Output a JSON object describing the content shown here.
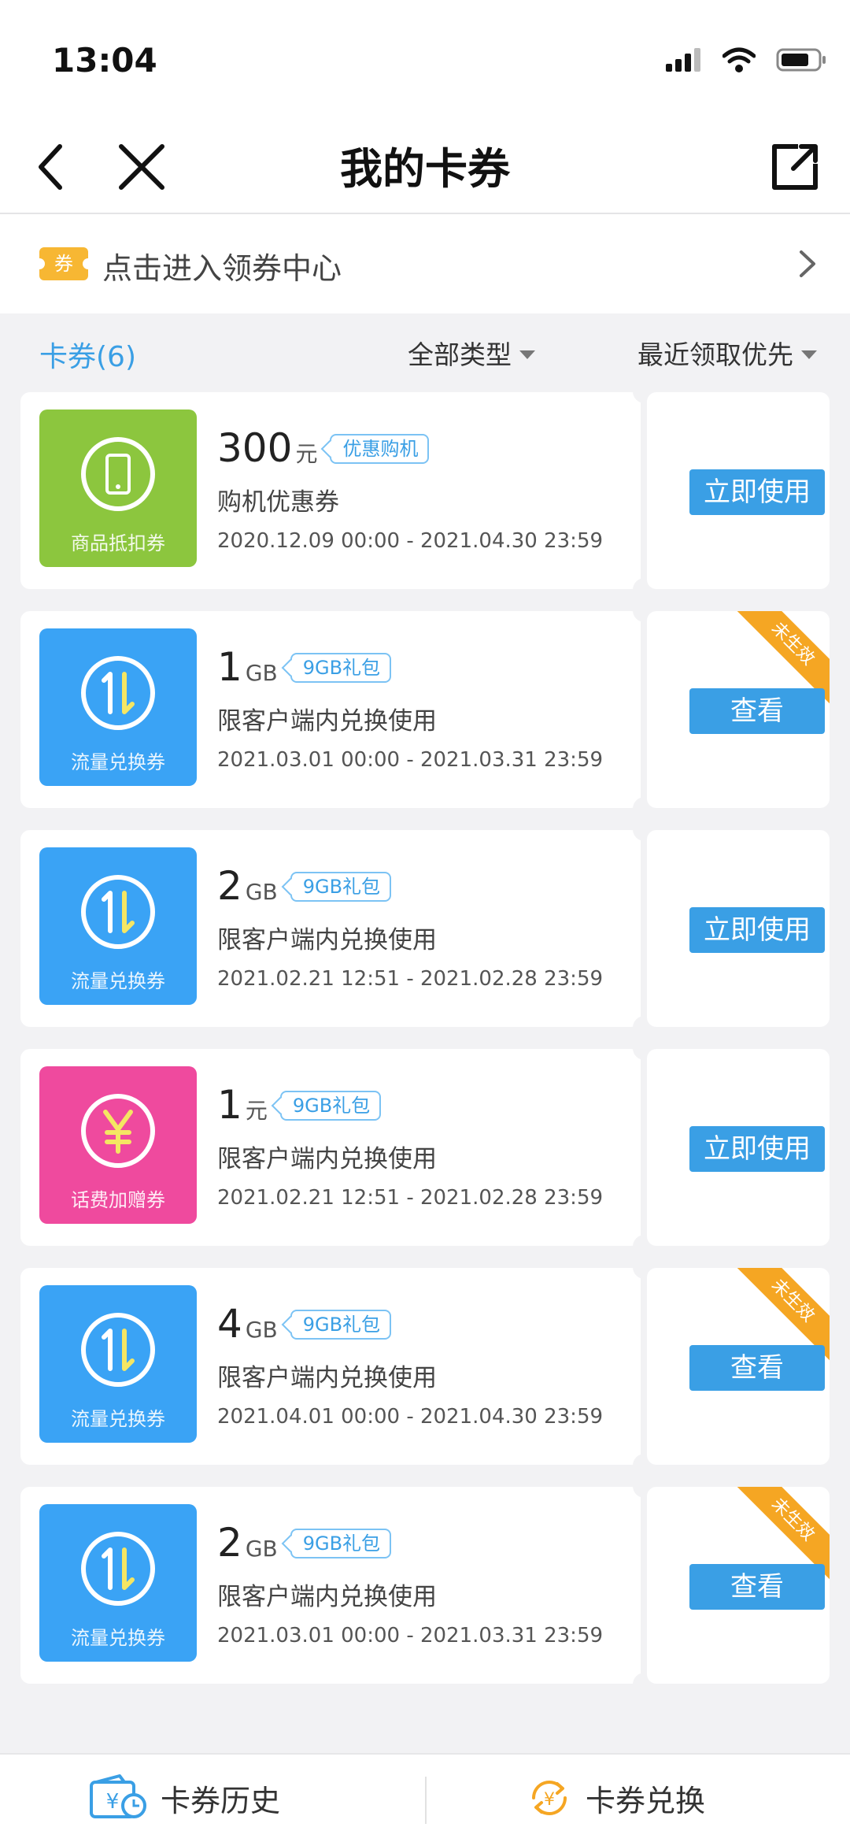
{
  "status": {
    "time": "13:04"
  },
  "nav": {
    "title": "我的卡券"
  },
  "coupon_center": {
    "badge": "券",
    "label": "点击进入领券中心"
  },
  "filters": {
    "count_label": "卡券(6)",
    "type_label": "全部类型",
    "sort_label": "最近领取优先"
  },
  "cards": [
    {
      "icon": "phone-icon",
      "color": "#8cc63e",
      "icon_label": "商品抵扣券",
      "amount": "300",
      "unit": "元",
      "tag": "优惠购机",
      "desc": "购机优惠券",
      "dates": "2020.12.09 00:00 - 2021.04.30 23:59",
      "action": "立即使用",
      "ribbon": ""
    },
    {
      "icon": "data-exchange-icon",
      "color": "#3aa3f5",
      "icon_label": "流量兑换券",
      "amount": "1",
      "unit": "GB",
      "tag": "9GB礼包",
      "desc": "限客户端内兑换使用",
      "dates": "2021.03.01 00:00 - 2021.03.31 23:59",
      "action": "查看",
      "ribbon": "未生效"
    },
    {
      "icon": "data-exchange-icon",
      "color": "#3aa3f5",
      "icon_label": "流量兑换券",
      "amount": "2",
      "unit": "GB",
      "tag": "9GB礼包",
      "desc": "限客户端内兑换使用",
      "dates": "2021.02.21 12:51 - 2021.02.28 23:59",
      "action": "立即使用",
      "ribbon": ""
    },
    {
      "icon": "yuan-icon",
      "color": "#ef4a9e",
      "icon_label": "话费加赠券",
      "amount": "1",
      "unit": "元",
      "tag": "9GB礼包",
      "desc": "限客户端内兑换使用",
      "dates": "2021.02.21 12:51 - 2021.02.28 23:59",
      "action": "立即使用",
      "ribbon": ""
    },
    {
      "icon": "data-exchange-icon",
      "color": "#3aa3f5",
      "icon_label": "流量兑换券",
      "amount": "4",
      "unit": "GB",
      "tag": "9GB礼包",
      "desc": "限客户端内兑换使用",
      "dates": "2021.04.01 00:00 - 2021.04.30 23:59",
      "action": "查看",
      "ribbon": "未生效"
    },
    {
      "icon": "data-exchange-icon",
      "color": "#3aa3f5",
      "icon_label": "流量兑换券",
      "amount": "2",
      "unit": "GB",
      "tag": "9GB礼包",
      "desc": "限客户端内兑换使用",
      "dates": "2021.03.01 00:00 - 2021.03.31 23:59",
      "action": "查看",
      "ribbon": "未生效"
    }
  ],
  "bottom": {
    "history_label": "卡券历史",
    "exchange_label": "卡券兑换"
  }
}
